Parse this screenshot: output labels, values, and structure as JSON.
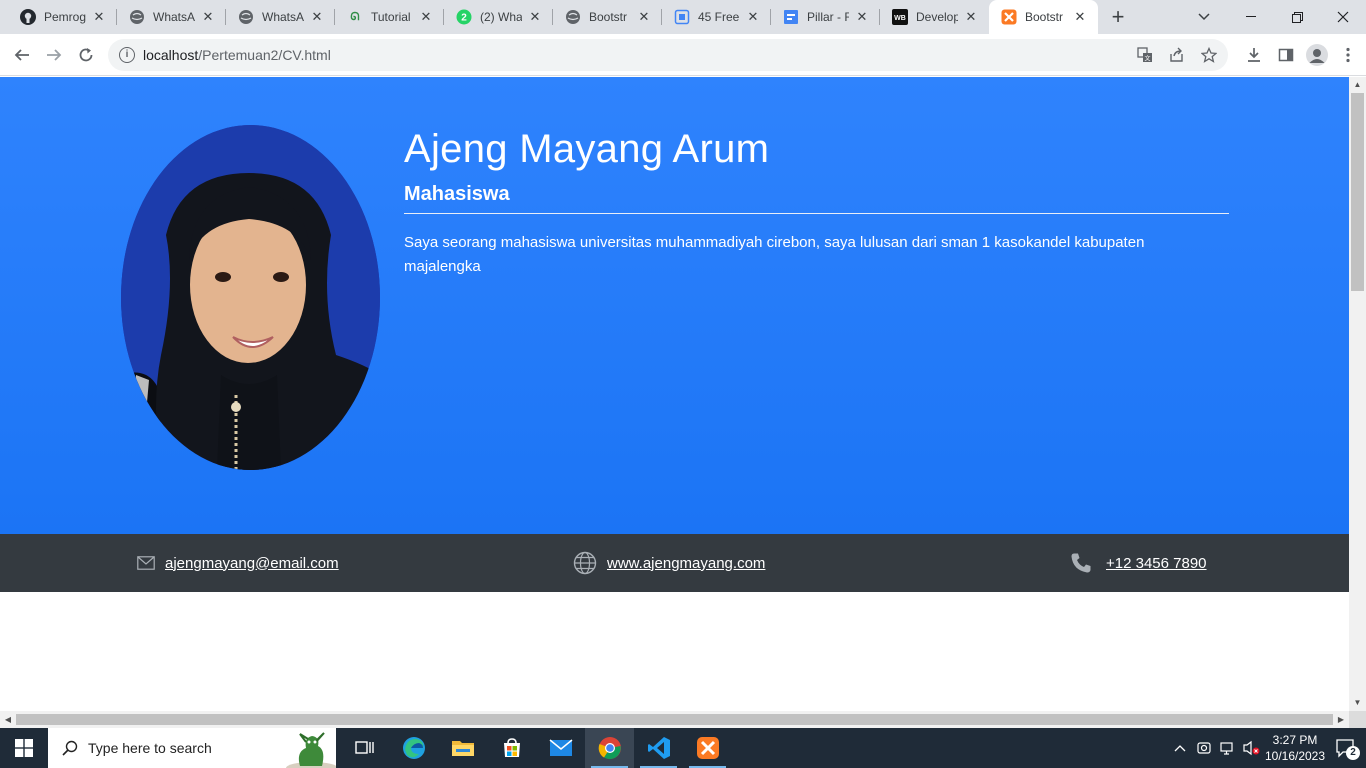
{
  "browser": {
    "tabs": [
      {
        "title": "Pemrog",
        "favicon": "github-icon"
      },
      {
        "title": "WhatsA",
        "favicon": "globe-icon"
      },
      {
        "title": "WhatsA",
        "favicon": "globe-icon"
      },
      {
        "title": "Tutorial",
        "favicon": "gfg-icon"
      },
      {
        "title": "(2) Wha",
        "favicon": "whatsapp-icon",
        "badge": "2"
      },
      {
        "title": "Bootstr",
        "favicon": "globe-icon"
      },
      {
        "title": "45 Free",
        "favicon": "template-icon"
      },
      {
        "title": "Pillar - F",
        "favicon": "pillar-icon"
      },
      {
        "title": "Develop",
        "favicon": "wb-icon",
        "badge": "WB"
      },
      {
        "title": "Bootstr",
        "favicon": "xampp-icon",
        "active": true
      }
    ],
    "url_host": "localhost",
    "url_path": "/Pertemuan2/CV.html"
  },
  "cv": {
    "name": "Ajeng Mayang Arum",
    "role": "Mahasiswa",
    "bio": "Saya seorang mahasiswa universitas muhammadiyah cirebon, saya lulusan dari sman 1 kasokandel kabupaten majalengka",
    "email": "ajengmayang@email.com",
    "website": "www.ajengmayang.com",
    "phone": "+12 3456 7890"
  },
  "taskbar": {
    "search_placeholder": "Type here to search",
    "time": "3:27 PM",
    "date": "10/16/2023",
    "notification_count": "2"
  },
  "colors": {
    "hero": "#2f83fd",
    "contact_bar": "#343a40",
    "photo_bg": "#1d3fb3"
  }
}
